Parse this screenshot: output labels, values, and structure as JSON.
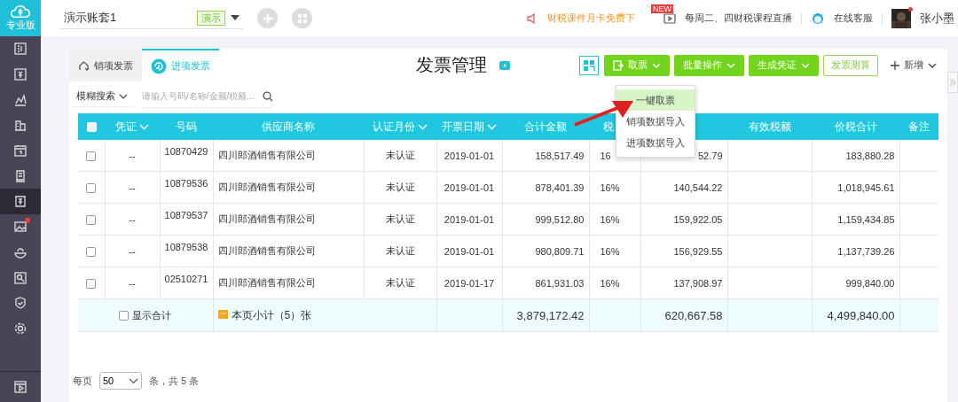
{
  "brand": {
    "label": "专业版"
  },
  "sidebar": {
    "items": [
      {
        "selected": false,
        "badge": false
      },
      {
        "selected": false,
        "badge": false
      },
      {
        "selected": false,
        "badge": false
      },
      {
        "selected": false,
        "badge": false
      },
      {
        "selected": false,
        "badge": false
      },
      {
        "selected": false,
        "badge": false
      },
      {
        "selected": true,
        "badge": false
      },
      {
        "selected": false,
        "badge": true
      },
      {
        "selected": false,
        "badge": false
      },
      {
        "selected": false,
        "badge": false
      },
      {
        "selected": false,
        "badge": false
      },
      {
        "selected": false,
        "badge": false
      }
    ],
    "bottom_items": [
      {
        "selected": false,
        "badge": false
      }
    ]
  },
  "topbar": {
    "account": "演示账套1",
    "account_tag": "演示",
    "notice": "财税课件月卡免费下",
    "live_badge": "NEW",
    "live": "每周二、四财税课程直播",
    "service": "在线客服",
    "user": "张小墨",
    "user_badge": true
  },
  "tabs": [
    {
      "label": "销项发票",
      "selected": false
    },
    {
      "label": "进项发票",
      "selected": true
    }
  ],
  "title": "发票管理",
  "toolbar": {
    "buttons": [
      {
        "kind": "dropdown",
        "label": "取票",
        "icon": true
      },
      {
        "kind": "dropdown",
        "label": "批量操作",
        "icon": false
      },
      {
        "kind": "dropdown",
        "label": "生成凭证",
        "icon": false
      },
      {
        "kind": "outline",
        "label": "发票测算",
        "icon": false
      },
      {
        "kind": "plain",
        "label": "新增",
        "icon": true
      }
    ]
  },
  "search": {
    "mode": "模糊搜索",
    "placeholder": "请输入号码/名称/金额/税额..."
  },
  "dropdown_menu": {
    "items": [
      {
        "label": "一键取票",
        "selected": true
      },
      {
        "label": "销项数据导入",
        "selected": false
      },
      {
        "label": "进项数据导入",
        "selected": false
      }
    ]
  },
  "table": {
    "header_checked": false,
    "columns": [
      {
        "label": "凭证",
        "has_menu": true
      },
      {
        "label": "号码",
        "has_menu": false
      },
      {
        "label": "供应商名称",
        "has_menu": false
      },
      {
        "label": "认证月份",
        "has_menu": true
      },
      {
        "label": "开票日期",
        "has_menu": true
      },
      {
        "label": "合计金额",
        "has_menu": false
      },
      {
        "label": "税"
      },
      {},
      {
        "label": "有效税额",
        "has_menu": false
      },
      {
        "label": "价税合计",
        "has_menu": false
      },
      {
        "label": "备注",
        "has_menu": false
      }
    ],
    "rows": [
      {
        "checked": false,
        "cells": [
          "--",
          "10870429",
          "四川郎酒销售有限公司",
          "未认证",
          "2019-01-01",
          "158,517.49",
          "16",
          "52.79",
          "",
          "183,880.28",
          ""
        ]
      },
      {
        "checked": false,
        "cells": [
          "--",
          "10879536",
          "四川郎酒销售有限公司",
          "未认证",
          "2019-01-01",
          "878,401.39",
          "16%",
          "140,544.22",
          "",
          "1,018,945.61",
          ""
        ]
      },
      {
        "checked": false,
        "cells": [
          "--",
          "10879537",
          "四川郎酒销售有限公司",
          "未认证",
          "2019-01-01",
          "999,512.80",
          "16%",
          "159,922.05",
          "",
          "1,159,434.85",
          ""
        ]
      },
      {
        "checked": false,
        "cells": [
          "--",
          "10879538",
          "四川郎酒销售有限公司",
          "未认证",
          "2019-01-01",
          "980,809.71",
          "16%",
          "156,929.55",
          "",
          "1,137,739.26",
          ""
        ]
      },
      {
        "checked": false,
        "cells": [
          "--",
          "02510271",
          "四川郎酒销售有限公司",
          "未认证",
          "2019-01-17",
          "861,931.03",
          "16%",
          "137,908.97",
          "",
          "999,840.00",
          ""
        ]
      }
    ],
    "summary": {
      "show_total_label": "显示合计",
      "show_total_checked": false,
      "subtotal": "本页小计（5）张",
      "amount": "3,879,172.42",
      "tax": "620,667.58",
      "total": "4,499,840.00"
    }
  },
  "pagination": {
    "per_page_label": "每页",
    "per_page": "50",
    "count": "条，共 5 条"
  }
}
